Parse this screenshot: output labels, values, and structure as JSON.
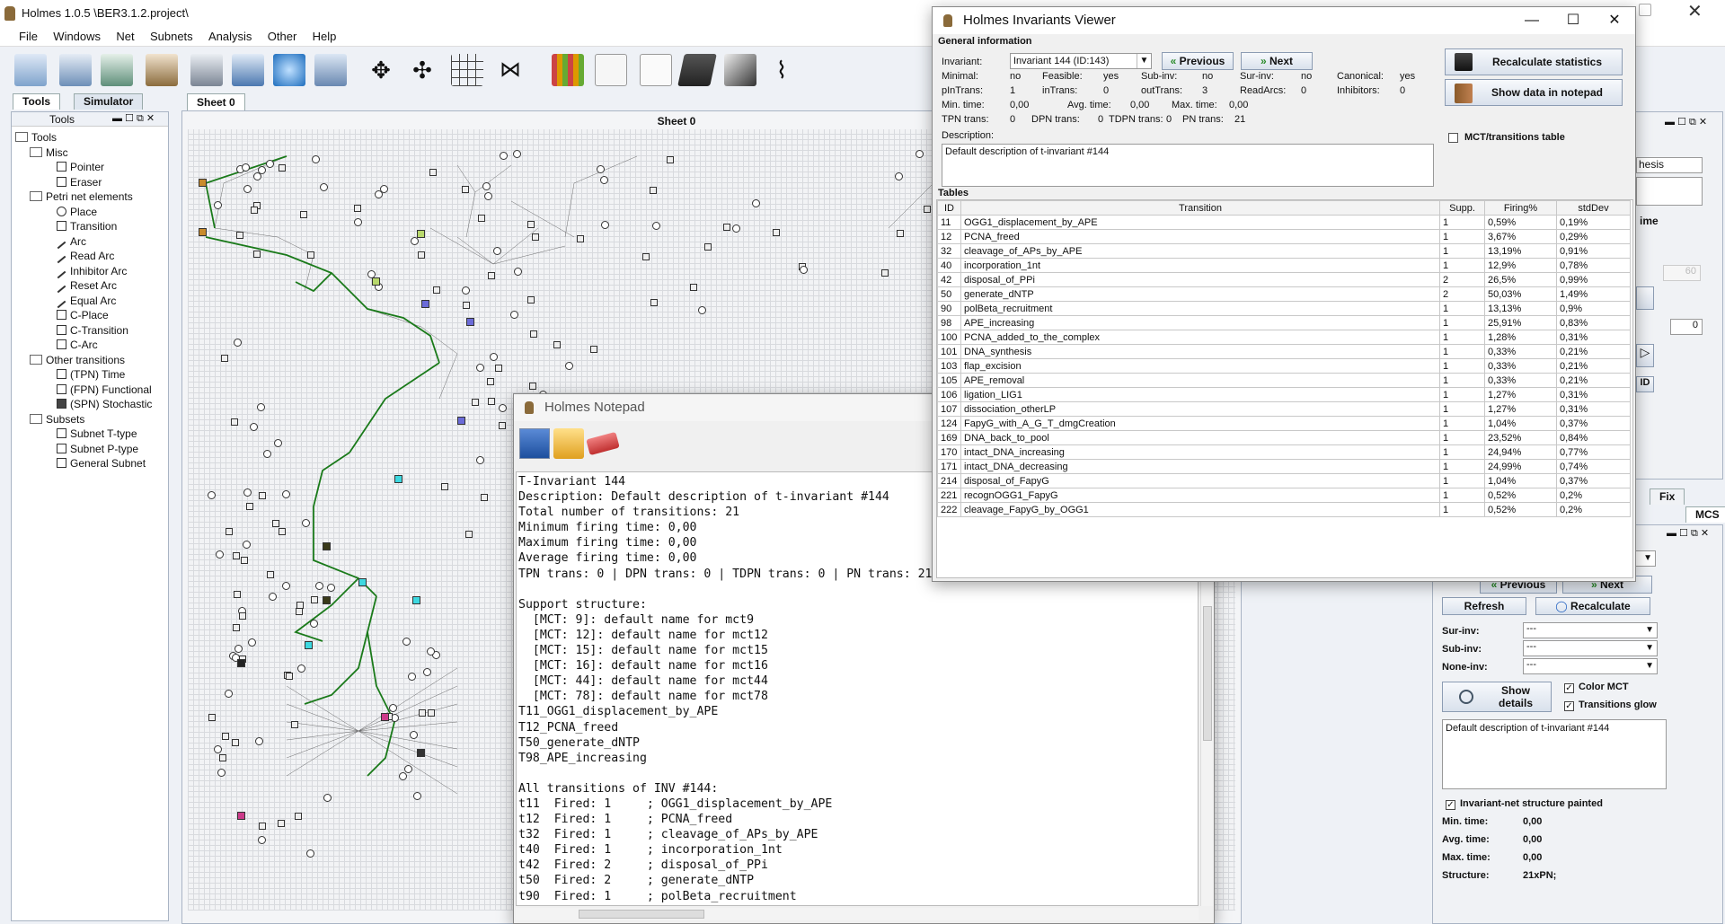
{
  "app": {
    "title": "Holmes 1.0.5  \\BER3.1.2.project\\"
  },
  "menu": [
    "File",
    "Windows",
    "Net",
    "Subnets",
    "Analysis",
    "Other",
    "Help"
  ],
  "left_tabs": [
    "Tools",
    "Simulator"
  ],
  "tools_title": "Tools",
  "tree": [
    {
      "label": "Tools",
      "level": 0,
      "icon": "folder-icon"
    },
    {
      "label": "Misc",
      "level": 1,
      "icon": "folder-icon"
    },
    {
      "label": "Pointer",
      "level": 2,
      "icon": "pointer-icon"
    },
    {
      "label": "Eraser",
      "level": 2,
      "icon": "eraser-icon"
    },
    {
      "label": "Petri net elements",
      "level": 1,
      "icon": "folder-icon"
    },
    {
      "label": "Place",
      "level": 2,
      "icon": "place-icon"
    },
    {
      "label": "Transition",
      "level": 2,
      "icon": "transition-icon"
    },
    {
      "label": "Arc",
      "level": 2,
      "icon": "arc-icon"
    },
    {
      "label": "Read Arc",
      "level": 2,
      "icon": "read-arc-icon"
    },
    {
      "label": "Inhibitor Arc",
      "level": 2,
      "icon": "inhibitor-arc-icon"
    },
    {
      "label": "Reset Arc",
      "level": 2,
      "icon": "reset-arc-icon"
    },
    {
      "label": "Equal Arc",
      "level": 2,
      "icon": "equal-arc-icon"
    },
    {
      "label": "C-Place",
      "level": 2,
      "icon": "c-place-icon"
    },
    {
      "label": "C-Transition",
      "level": 2,
      "icon": "c-transition-icon"
    },
    {
      "label": "C-Arc",
      "level": 2,
      "icon": "c-arc-icon"
    },
    {
      "label": "Other transitions",
      "level": 1,
      "icon": "folder-icon"
    },
    {
      "label": "(TPN) Time",
      "level": 2,
      "icon": "time-transition-icon"
    },
    {
      "label": "(FPN) Functional",
      "level": 2,
      "icon": "functional-transition-icon"
    },
    {
      "label": "(SPN) Stochastic",
      "level": 2,
      "icon": "stochastic-transition-icon"
    },
    {
      "label": "Subsets",
      "level": 1,
      "icon": "folder-icon"
    },
    {
      "label": "Subnet T-type",
      "level": 2,
      "icon": "subnet-icon"
    },
    {
      "label": "Subnet P-type",
      "level": 2,
      "icon": "subnet-icon"
    },
    {
      "label": "General Subnet",
      "level": 2,
      "icon": "subnet-icon"
    }
  ],
  "sheet": {
    "tab": "Sheet 0",
    "title": "Sheet 0"
  },
  "viewer": {
    "title": "Holmes Invariants Viewer",
    "general_label": "General information",
    "invariant_label": "Invariant:",
    "invariant_value": "Invariant 144 (ID:143)",
    "previous": "Previous",
    "next": "Next",
    "recalc": "Recalculate statistics",
    "notepad": "Show data in notepad",
    "mct_table": "MCT/transitions table",
    "stats": {
      "minimal_l": "Minimal:",
      "minimal_v": "no",
      "feasible_l": "Feasible:",
      "feasible_v": "yes",
      "subinv_l": "Sub-inv:",
      "subinv_v": "no",
      "surinv_l": "Sur-inv:",
      "surinv_v": "no",
      "canonical_l": "Canonical:",
      "canonical_v": "yes",
      "pin_l": "pInTrans:",
      "pin_v": "1",
      "in_l": "inTrans:",
      "in_v": "0",
      "out_l": "outTrans:",
      "out_v": "3",
      "read_l": "ReadArcs:",
      "read_v": "0",
      "inh_l": "Inhibitors:",
      "inh_v": "0",
      "mint_l": "Min. time:",
      "mint_v": "0,00",
      "avgt_l": "Avg. time:",
      "avgt_v": "0,00",
      "maxt_l": "Max. time:",
      "maxt_v": "0,00",
      "tpn_l": "TPN trans:",
      "tpn_v": "0",
      "dpn_l": "DPN trans:",
      "dpn_v": "0",
      "tdpn_l": "TDPN trans:",
      "tdpn_v": "0",
      "pn_l": "PN trans:",
      "pn_v": "21"
    },
    "description_label": "Description:",
    "description": "Default description of t-invariant #144",
    "tables_label": "Tables",
    "columns": [
      "ID",
      "Transition",
      "Supp.",
      "Firing%",
      "stdDev"
    ],
    "rows": [
      [
        "11",
        "OGG1_displacement_by_APE",
        "1",
        "0,59%",
        "0,19%"
      ],
      [
        "12",
        "PCNA_freed",
        "1",
        "3,67%",
        "0,29%"
      ],
      [
        "32",
        "cleavage_of_APs_by_APE",
        "1",
        "13,19%",
        "0,91%"
      ],
      [
        "40",
        "incorporation_1nt",
        "1",
        "12,9%",
        "0,78%"
      ],
      [
        "42",
        "disposal_of_PPi",
        "2",
        "26,5%",
        "0,99%"
      ],
      [
        "50",
        "generate_dNTP",
        "2",
        "50,03%",
        "1,49%"
      ],
      [
        "90",
        "polBeta_recruitment",
        "1",
        "13,13%",
        "0,9%"
      ],
      [
        "98",
        "APE_increasing",
        "1",
        "25,91%",
        "0,83%"
      ],
      [
        "100",
        "PCNA_added_to_the_complex",
        "1",
        "1,28%",
        "0,31%"
      ],
      [
        "101",
        "DNA_synthesis",
        "1",
        "0,33%",
        "0,21%"
      ],
      [
        "103",
        "flap_excision",
        "1",
        "0,33%",
        "0,21%"
      ],
      [
        "105",
        "APE_removal",
        "1",
        "0,33%",
        "0,21%"
      ],
      [
        "106",
        "ligation_LIG1",
        "1",
        "1,27%",
        "0,31%"
      ],
      [
        "107",
        "dissociation_otherLP",
        "1",
        "1,27%",
        "0,31%"
      ],
      [
        "124",
        "FapyG_with_A_G_T_dmgCreation",
        "1",
        "1,04%",
        "0,37%"
      ],
      [
        "169",
        "DNA_back_to_pool",
        "1",
        "23,52%",
        "0,84%"
      ],
      [
        "170",
        "intact_DNA_increasing",
        "1",
        "24,94%",
        "0,77%"
      ],
      [
        "171",
        "intact_DNA_decreasing",
        "1",
        "24,99%",
        "0,74%"
      ],
      [
        "214",
        "disposal_of_FapyG",
        "1",
        "1,04%",
        "0,37%"
      ],
      [
        "221",
        "recognOGG1_FapyG",
        "1",
        "0,52%",
        "0,2%"
      ],
      [
        "222",
        "cleavage_FapyG_by_OGG1",
        "1",
        "0,52%",
        "0,2%"
      ]
    ]
  },
  "notepad": {
    "title": "Holmes Notepad",
    "lines": [
      "T-Invariant 144",
      "Description: Default description of t-invariant #144",
      "Total number of transitions: 21",
      "Minimum firing time: 0,00",
      "Maximum firing time: 0,00",
      "Average firing time: 0,00",
      "TPN trans: 0 | DPN trans: 0 | TDPN trans: 0 | PN trans: 21",
      "",
      "Support structure:",
      "  [MCT: 9]: default name for mct9",
      "  [MCT: 12]: default name for mct12",
      "  [MCT: 15]: default name for mct15",
      "  [MCT: 16]: default name for mct16",
      "  [MCT: 44]: default name for mct44",
      "  [MCT: 78]: default name for mct78",
      "T11_OGG1_displacement_by_APE",
      "T12_PCNA_freed",
      "T50_generate_dNTP",
      "T98_APE_increasing",
      "",
      "All transitions of INV #144:",
      "t11  Fired: 1     ; OGG1_displacement_by_APE",
      "t12  Fired: 1     ; PCNA_freed",
      "t32  Fired: 1     ; cleavage_of_APs_by_APE",
      "t40  Fired: 1     ; incorporation_1nt",
      "t42  Fired: 2     ; disposal_of_PPi",
      "t50  Fired: 2     ; generate_dNTP",
      "t90  Fired: 1     ; polBeta_recruitment"
    ]
  },
  "right": {
    "synth_frag": "hesis",
    "time_frag": "ime",
    "zero": "0",
    "id_frag": "ID",
    "tab_fix": "Fix",
    "tab_mcs": "MCS",
    "previous": "Previous",
    "next": "Next",
    "refresh": "Refresh",
    "recalculate": "Recalculate",
    "surinv_l": "Sur-inv:",
    "surinv_v": "---",
    "subinv_l": "Sub-inv:",
    "subinv_v": "---",
    "noneinv_l": "None-inv:",
    "noneinv_v": "---",
    "show_details": "Show details",
    "color_mct": "Color MCT",
    "transitions_glow": "Transitions glow",
    "description": "Default description of t-invariant #144",
    "painted": "Invariant-net structure painted",
    "mint_l": "Min. time:",
    "mint_v": "0,00",
    "avgt_l": "Avg. time:",
    "avgt_v": "0,00",
    "maxt_l": "Max. time:",
    "maxt_v": "0,00",
    "struct_l": "Structure:",
    "struct_v": "21xPN;"
  }
}
